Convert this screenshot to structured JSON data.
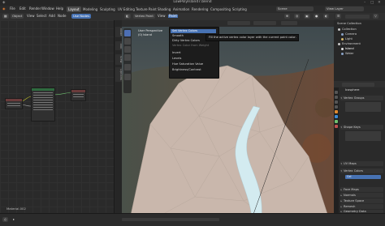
{
  "window": {
    "title": "LowPolyIsland7.blend"
  },
  "menubar": {
    "menus": [
      "File",
      "Edit",
      "Render",
      "Window",
      "Help"
    ],
    "workspaces": [
      "Layout",
      "Modeling",
      "Sculpting",
      "UV Editing",
      "Texture Paint",
      "Shading",
      "Animation",
      "Rendering",
      "Compositing",
      "Scripting"
    ],
    "active_workspace": "Layout",
    "scene": "Scene",
    "view_layer": "View Layer"
  },
  "node_editor": {
    "header": [
      "Object",
      "View",
      "Select",
      "Add",
      "Node",
      "Use Nodes"
    ],
    "material_label": "Material.002"
  },
  "left_sidebar_tabs": [
    "Node",
    "Tool",
    "View",
    "Options"
  ],
  "viewport": {
    "header_mode": "Vertex Paint",
    "header_items": [
      "View",
      "Paint"
    ],
    "overlay_label": "User Perspective",
    "overlay_sub": "(0) Island",
    "dropdown": {
      "items": [
        "Set Vertex Colors",
        "Smooth",
        "Dirty Vertex Colors",
        "Vertex Color from Weight",
        "Invert",
        "Levels",
        "Hue Saturation Value",
        "Brightness/Contrast"
      ],
      "highlighted": "Set Vertex Colors",
      "tooltip": "Fill the active vertex color layer with the current paint color."
    }
  },
  "outliner": {
    "title": "Scene Collection",
    "items": [
      "Collection",
      "Camera",
      "Light",
      "Environment",
      "Island",
      "Water"
    ],
    "item_colors": [
      "#c8c8c8",
      "#8aa3c8",
      "#d6b86b",
      "#c8c8c8",
      "#e0e0e0",
      "#8aa3c8"
    ]
  },
  "properties": {
    "object_name": "Island",
    "sections": [
      "Vertex Groups",
      "Shape Keys",
      "UV Maps",
      "Vertex Colors",
      "Face Maps",
      "Normals",
      "Texture Space",
      "Remesh",
      "Geometry Data"
    ],
    "vertex_color_layer": "Col",
    "name_field": "Icosphere"
  },
  "colors": {
    "accent": "#4772b3",
    "sky": "#4f5a5c",
    "mesh": "#c9b7ac",
    "water": "#d3ebf0"
  }
}
